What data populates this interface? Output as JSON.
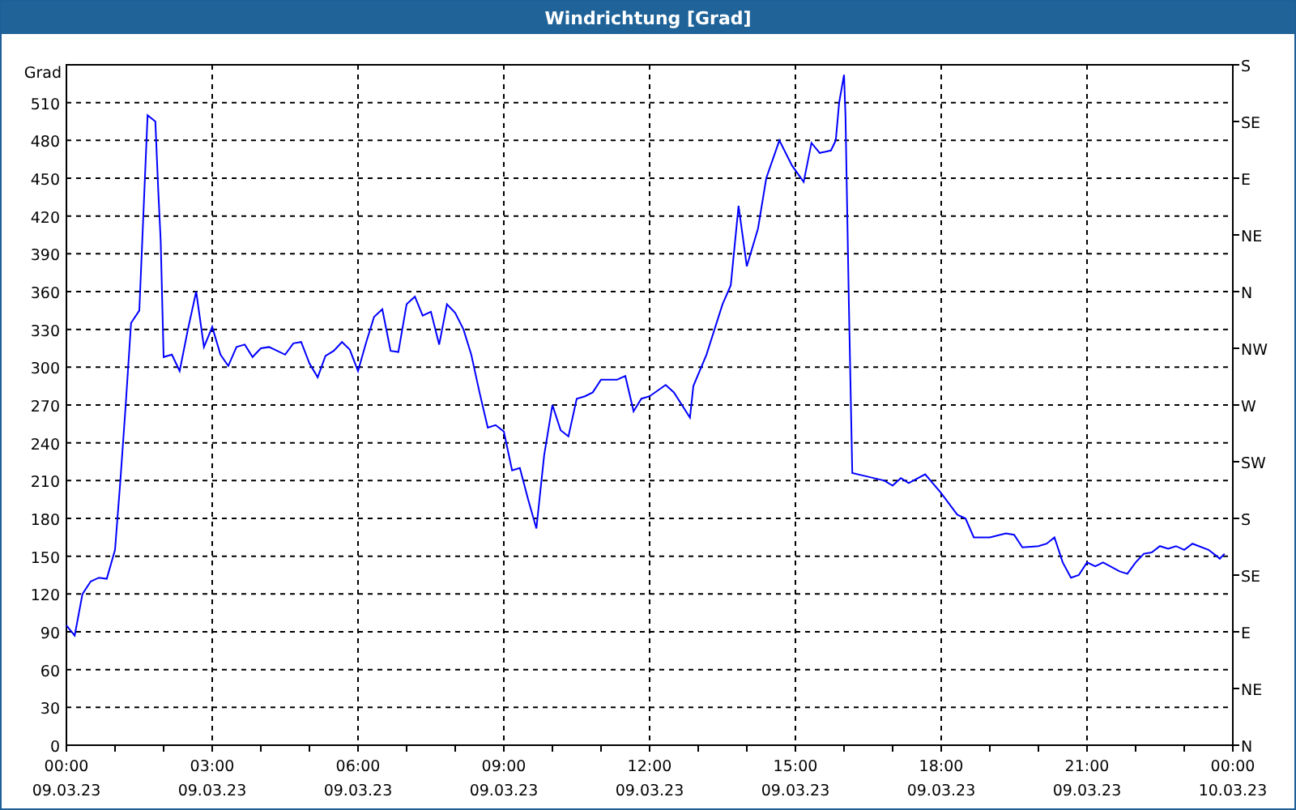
{
  "window": {
    "title": "Windrichtung [Grad]"
  },
  "chart": {
    "tick_dates": [
      "09.03.23",
      "09.03.23",
      "09.03.23",
      "09.03.23",
      "09.03.23",
      "09.03.23",
      "09.03.23",
      "09.03.23",
      "10.03.23"
    ],
    "compass_labels": [
      "S",
      "SE",
      "E",
      "NE",
      "N",
      "NW",
      "W",
      "SW",
      "S",
      "SE",
      "E",
      "NE",
      "N"
    ],
    "chart_data": {
      "type": "line",
      "grid": true,
      "ylabel": "Grad",
      "xlim": [
        0,
        24
      ],
      "ylim": [
        0,
        540
      ],
      "yticks": [
        0,
        30,
        60,
        90,
        120,
        150,
        180,
        210,
        240,
        270,
        300,
        330,
        360,
        390,
        420,
        450,
        480,
        510
      ],
      "xticks": [
        {
          "value": 0,
          "label": "00:00"
        },
        {
          "value": 3,
          "label": "03:00"
        },
        {
          "value": 6,
          "label": "06:00"
        },
        {
          "value": 9,
          "label": "09:00"
        },
        {
          "value": 12,
          "label": "12:00"
        },
        {
          "value": 15,
          "label": "15:00"
        },
        {
          "value": 18,
          "label": "18:00"
        },
        {
          "value": 21,
          "label": "21:00"
        },
        {
          "value": 24,
          "label": "00:00"
        }
      ],
      "x": [
        0,
        0.17,
        0.33,
        0.5,
        0.67,
        0.83,
        1.0,
        1.11,
        1.22,
        1.33,
        1.5,
        1.67,
        1.83,
        1.89,
        1.94,
        2.0,
        2.17,
        2.33,
        2.5,
        2.67,
        2.83,
        3.0,
        3.17,
        3.33,
        3.5,
        3.67,
        3.83,
        4.0,
        4.17,
        4.5,
        4.67,
        4.83,
        5.0,
        5.17,
        5.33,
        5.5,
        5.67,
        5.83,
        6.0,
        6.17,
        6.33,
        6.5,
        6.67,
        6.83,
        7.0,
        7.17,
        7.33,
        7.5,
        7.67,
        7.83,
        8.0,
        8.17,
        8.33,
        8.5,
        8.67,
        8.83,
        9.0,
        9.17,
        9.33,
        9.5,
        9.67,
        9.83,
        10.0,
        10.17,
        10.33,
        10.5,
        10.67,
        10.83,
        11.0,
        11.33,
        11.5,
        11.67,
        11.83,
        12.0,
        12.33,
        12.5,
        12.83,
        12.9,
        13.17,
        13.5,
        13.67,
        13.83,
        14.0,
        14.23,
        14.4,
        14.67,
        14.93,
        15.17,
        15.33,
        15.5,
        15.73,
        15.83,
        15.9,
        16.0,
        16.03,
        16.1,
        16.17,
        16.5,
        16.83,
        17.0,
        17.17,
        17.33,
        17.67,
        18.0,
        18.33,
        18.5,
        18.67,
        19.0,
        19.33,
        19.5,
        19.67,
        20.0,
        20.17,
        20.33,
        20.5,
        20.67,
        20.83,
        21.0,
        21.17,
        21.33,
        21.67,
        21.83,
        22.0,
        22.17,
        22.33,
        22.5,
        22.67,
        22.83,
        23.0,
        23.17,
        23.5,
        23.67,
        23.73,
        23.83
      ],
      "series": [
        {
          "color": "#0000ff",
          "values": [
            95,
            87,
            120,
            130,
            133,
            132,
            155,
            210,
            270,
            335,
            345,
            500,
            495,
            440,
            400,
            308,
            310,
            297,
            330,
            360,
            316,
            332,
            310,
            301,
            316,
            318,
            308,
            315,
            316,
            310,
            319,
            320,
            303,
            292,
            309,
            313,
            320,
            314,
            297,
            320,
            340,
            346,
            313,
            312,
            350,
            356,
            341,
            344,
            318,
            350,
            343,
            330,
            310,
            280,
            252,
            254,
            249,
            218,
            220,
            195,
            172,
            230,
            270,
            250,
            245,
            275,
            277,
            280,
            290,
            290,
            293,
            265,
            275,
            277,
            286,
            280,
            260,
            285,
            310,
            350,
            365,
            428,
            380,
            410,
            450,
            480,
            460,
            447,
            478,
            470,
            472,
            480,
            510,
            532,
            500,
            350,
            216,
            213,
            210,
            206,
            212,
            208,
            215,
            200,
            183,
            180,
            165,
            165,
            168,
            167,
            157,
            158,
            160,
            165,
            145,
            133,
            135,
            145,
            142,
            145,
            138,
            136,
            145,
            152,
            153,
            158,
            156,
            158,
            155,
            160,
            155,
            150,
            148,
            152
          ]
        }
      ]
    }
  }
}
